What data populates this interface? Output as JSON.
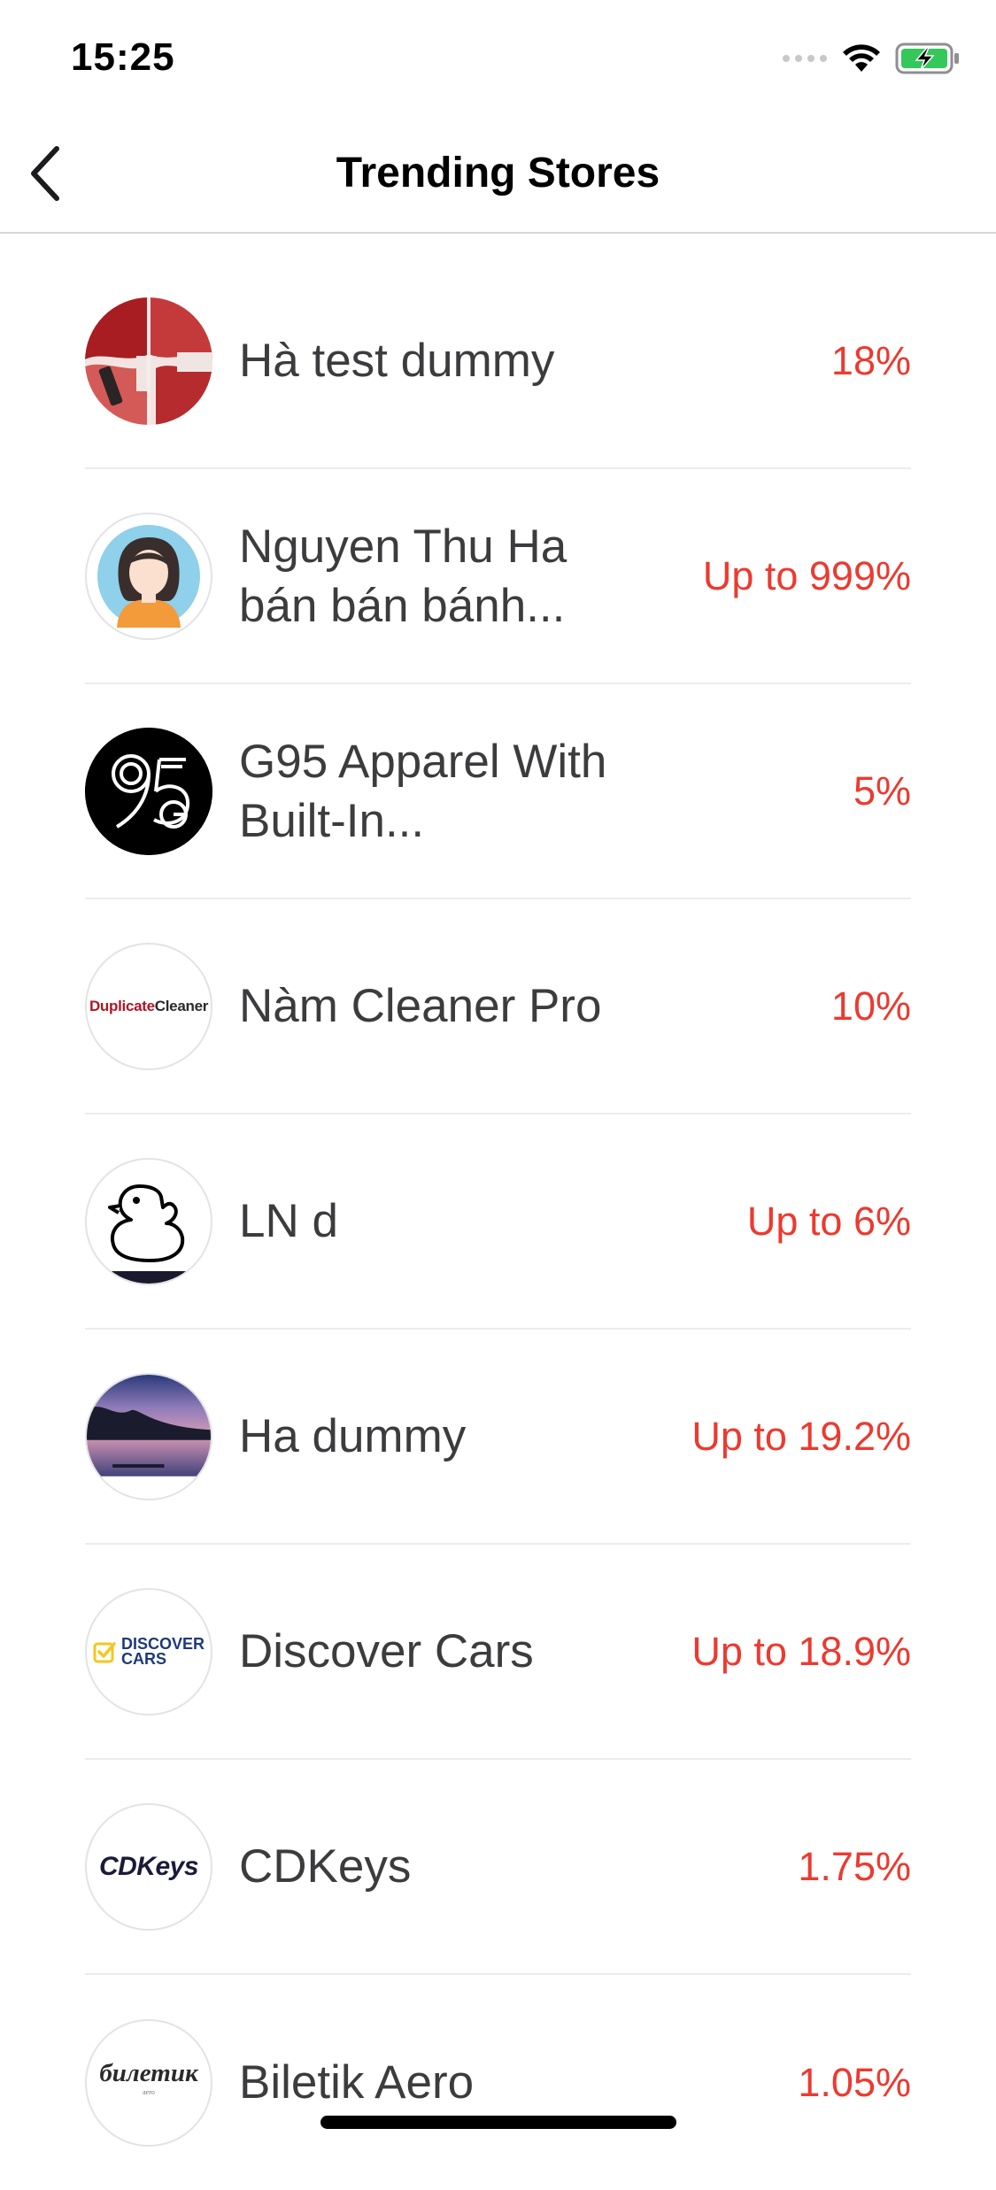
{
  "status_bar": {
    "time": "15:25"
  },
  "nav": {
    "title": "Trending Stores",
    "back_icon": "chevron-left-icon"
  },
  "stores": [
    {
      "name": "Hà test dummy",
      "cashback": "18%"
    },
    {
      "name": "Nguyen Thu Ha bán bán bánh...",
      "cashback": "Up to 999%"
    },
    {
      "name": "G95 Apparel With Built-In...",
      "cashback": "5%"
    },
    {
      "name": "Nàm Cleaner Pro",
      "cashback": "10%"
    },
    {
      "name": "LN d",
      "cashback": "Up to 6%"
    },
    {
      "name": "Ha dummy",
      "cashback": "Up to 19.2%"
    },
    {
      "name": "Discover Cars",
      "cashback": "Up to 18.9%"
    },
    {
      "name": "CDKeys",
      "cashback": "1.75%"
    },
    {
      "name": "Biletik Aero",
      "cashback": "1.05%"
    }
  ],
  "logos": {
    "duplicate_cleaner": {
      "part1": "Duplicate",
      "part2": "Cleaner"
    },
    "discover_cars": {
      "line1": "DISCOVER",
      "line2": "CARS"
    },
    "cdkeys": "CDKeys",
    "biletik": {
      "word": "билетик",
      "sub": "aero"
    }
  },
  "colors": {
    "accent_red": "#ec3a30",
    "text_primary": "#3c3c3e",
    "divider": "#ececef",
    "battery_green": "#34c759"
  }
}
